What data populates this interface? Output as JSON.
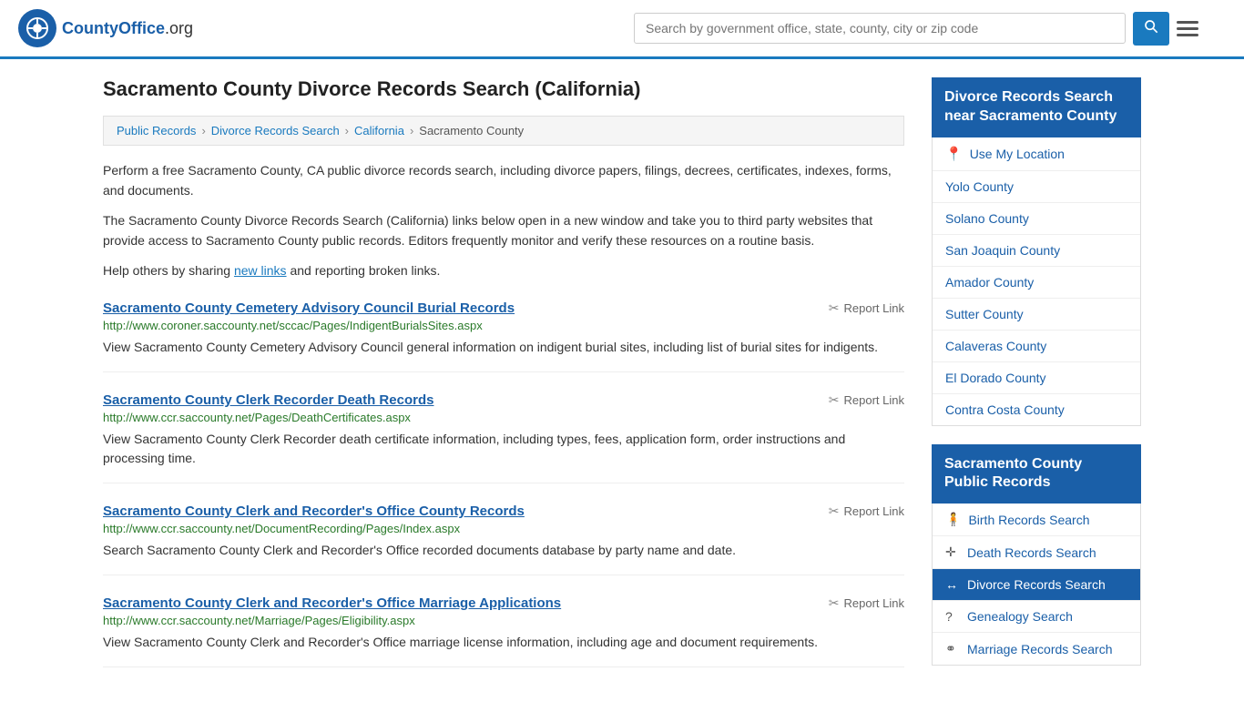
{
  "header": {
    "logo_text": "CountyOffice",
    "logo_suffix": ".org",
    "search_placeholder": "Search by government office, state, county, city or zip code"
  },
  "page": {
    "title": "Sacramento County Divorce Records Search (California)",
    "breadcrumb": [
      {
        "label": "Public Records",
        "href": "#"
      },
      {
        "label": "Divorce Records Search",
        "href": "#"
      },
      {
        "label": "California",
        "href": "#"
      },
      {
        "label": "Sacramento County",
        "href": "#"
      }
    ],
    "description1": "Perform a free Sacramento County, CA public divorce records search, including divorce papers, filings, decrees, certificates, indexes, forms, and documents.",
    "description2": "The Sacramento County Divorce Records Search (California) links below open in a new window and take you to third party websites that provide access to Sacramento County public records. Editors frequently monitor and verify these resources on a routine basis.",
    "description3_prefix": "Help others by sharing ",
    "description3_link": "new links",
    "description3_suffix": " and reporting broken links."
  },
  "records": [
    {
      "title": "Sacramento County Cemetery Advisory Council Burial Records",
      "url": "http://www.coroner.saccounty.net/sccac/Pages/IndigentBurialsSites.aspx",
      "description": "View Sacramento County Cemetery Advisory Council general information on indigent burial sites, including list of burial sites for indigents."
    },
    {
      "title": "Sacramento County Clerk Recorder Death Records",
      "url": "http://www.ccr.saccounty.net/Pages/DeathCertificates.aspx",
      "description": "View Sacramento County Clerk Recorder death certificate information, including types, fees, application form, order instructions and processing time."
    },
    {
      "title": "Sacramento County Clerk and Recorder's Office County Records",
      "url": "http://www.ccr.saccounty.net/DocumentRecording/Pages/Index.aspx",
      "description": "Search Sacramento County Clerk and Recorder's Office recorded documents database by party name and date."
    },
    {
      "title": "Sacramento County Clerk and Recorder's Office Marriage Applications",
      "url": "http://www.ccr.saccounty.net/Marriage/Pages/Eligibility.aspx",
      "description": "View Sacramento County Clerk and Recorder's Office marriage license information, including age and document requirements."
    }
  ],
  "sidebar": {
    "nearby_title": "Divorce Records Search\nnear Sacramento County",
    "use_location_label": "Use My Location",
    "nearby_counties": [
      {
        "label": "Yolo County"
      },
      {
        "label": "Solano County"
      },
      {
        "label": "San Joaquin County"
      },
      {
        "label": "Amador County"
      },
      {
        "label": "Sutter County"
      },
      {
        "label": "Calaveras County"
      },
      {
        "label": "El Dorado County"
      },
      {
        "label": "Contra Costa County"
      }
    ],
    "public_records_title": "Sacramento County Public\nRecords",
    "public_records_items": [
      {
        "label": "Birth Records Search",
        "icon": "person",
        "active": false
      },
      {
        "label": "Death Records Search",
        "icon": "cross",
        "active": false
      },
      {
        "label": "Divorce Records Search",
        "icon": "arrows",
        "active": true
      },
      {
        "label": "Genealogy Search",
        "icon": "question",
        "active": false
      },
      {
        "label": "Marriage Records Search",
        "icon": "rings",
        "active": false
      }
    ]
  }
}
